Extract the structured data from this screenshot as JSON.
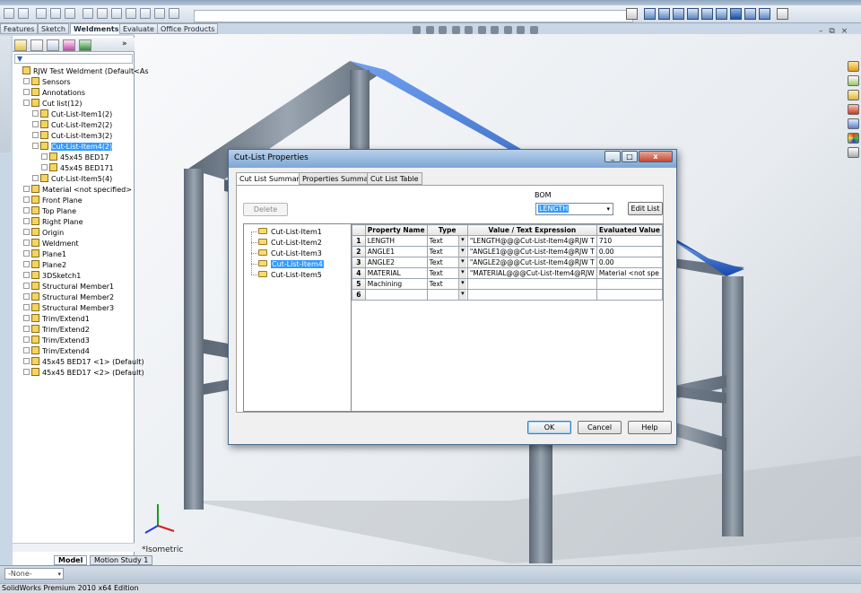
{
  "app": {
    "status_text": "SolidWorks Premium 2010 x64 Edition"
  },
  "command_tabs": [
    {
      "label": "Features"
    },
    {
      "label": "Sketch"
    },
    {
      "label": "Weldments"
    },
    {
      "label": "Evaluate"
    },
    {
      "label": "Office Products"
    }
  ],
  "viewport": {
    "view_label": "*Isometric"
  },
  "bottom": {
    "config_value": "-None-"
  },
  "model_tabs": [
    {
      "label": "Model"
    },
    {
      "label": "Motion Study 1"
    }
  ],
  "feature_tree": [
    {
      "label": "RJW Test Weldment  (Default<As",
      "depth": 0
    },
    {
      "label": "Sensors",
      "depth": 1
    },
    {
      "label": "Annotations",
      "depth": 1
    },
    {
      "label": "Cut list(12)",
      "depth": 1
    },
    {
      "label": "Cut-List-Item1(2)",
      "depth": 2
    },
    {
      "label": "Cut-List-Item2(2)",
      "depth": 2
    },
    {
      "label": "Cut-List-Item3(2)",
      "depth": 2
    },
    {
      "label": "Cut-List-Item4(2)",
      "depth": 2,
      "selected": true
    },
    {
      "label": "45x45 BED17",
      "depth": 3
    },
    {
      "label": "45x45 BED171",
      "depth": 3
    },
    {
      "label": "Cut-List-Item5(4)",
      "depth": 2
    },
    {
      "label": "Material <not specified>",
      "depth": 1
    },
    {
      "label": "Front Plane",
      "depth": 1
    },
    {
      "label": "Top Plane",
      "depth": 1
    },
    {
      "label": "Right Plane",
      "depth": 1
    },
    {
      "label": "Origin",
      "depth": 1
    },
    {
      "label": "Weldment",
      "depth": 1
    },
    {
      "label": "Plane1",
      "depth": 1
    },
    {
      "label": "Plane2",
      "depth": 1
    },
    {
      "label": "3DSketch1",
      "depth": 1
    },
    {
      "label": "Structural Member1",
      "depth": 1
    },
    {
      "label": "Structural Member2",
      "depth": 1
    },
    {
      "label": "Structural Member3",
      "depth": 1
    },
    {
      "label": "Trim/Extend1",
      "depth": 1
    },
    {
      "label": "Trim/Extend2",
      "depth": 1
    },
    {
      "label": "Trim/Extend3",
      "depth": 1
    },
    {
      "label": "Trim/Extend4",
      "depth": 1
    },
    {
      "label": "45x45 BED17 <1> (Default)",
      "depth": 1
    },
    {
      "label": "45x45 BED17 <2> (Default)",
      "depth": 1
    }
  ],
  "dialog": {
    "title": "Cut-List Properties",
    "close_glyph": "x",
    "tabs": [
      {
        "label": "Cut List Summary"
      },
      {
        "label": "Properties Summary"
      },
      {
        "label": "Cut List Table"
      }
    ],
    "delete_label": "Delete",
    "bom_label": "BOM",
    "bom_value": "LENGTH",
    "edit_list_label": "Edit List",
    "cutlist_items": [
      {
        "label": "Cut-List-Item1"
      },
      {
        "label": "Cut-List-Item2"
      },
      {
        "label": "Cut-List-Item3"
      },
      {
        "label": "Cut-List-Item4",
        "selected": true
      },
      {
        "label": "Cut-List-Item5"
      }
    ],
    "columns": [
      "Property Name",
      "Type",
      "Value / Text Expression",
      "Evaluated Value"
    ],
    "rows": [
      {
        "num": "1",
        "name": "LENGTH",
        "type": "Text",
        "value": "\"LENGTH@@@Cut-List-Item4@RJW T",
        "evaluated": "710"
      },
      {
        "num": "2",
        "name": "ANGLE1",
        "type": "Text",
        "value": "\"ANGLE1@@@Cut-List-Item4@RJW T",
        "evaluated": "0.00"
      },
      {
        "num": "3",
        "name": "ANGLE2",
        "type": "Text",
        "value": "\"ANGLE2@@@Cut-List-Item4@RJW T",
        "evaluated": "0.00"
      },
      {
        "num": "4",
        "name": "MATERIAL",
        "type": "Text",
        "value": "\"MATERIAL@@@Cut-List-Item4@RJW",
        "evaluated": "Material <not spe"
      },
      {
        "num": "5",
        "name": "Machining",
        "type": "Text",
        "value": "",
        "evaluated": ""
      },
      {
        "num": "6",
        "name": "",
        "type": "",
        "value": "",
        "evaluated": ""
      }
    ],
    "ok_label": "OK",
    "cancel_label": "Cancel",
    "help_label": "Help"
  },
  "colors": {
    "selection": "#3399ff",
    "model_highlight": "#1f5fc9",
    "frame_metal": "#7d8896"
  }
}
